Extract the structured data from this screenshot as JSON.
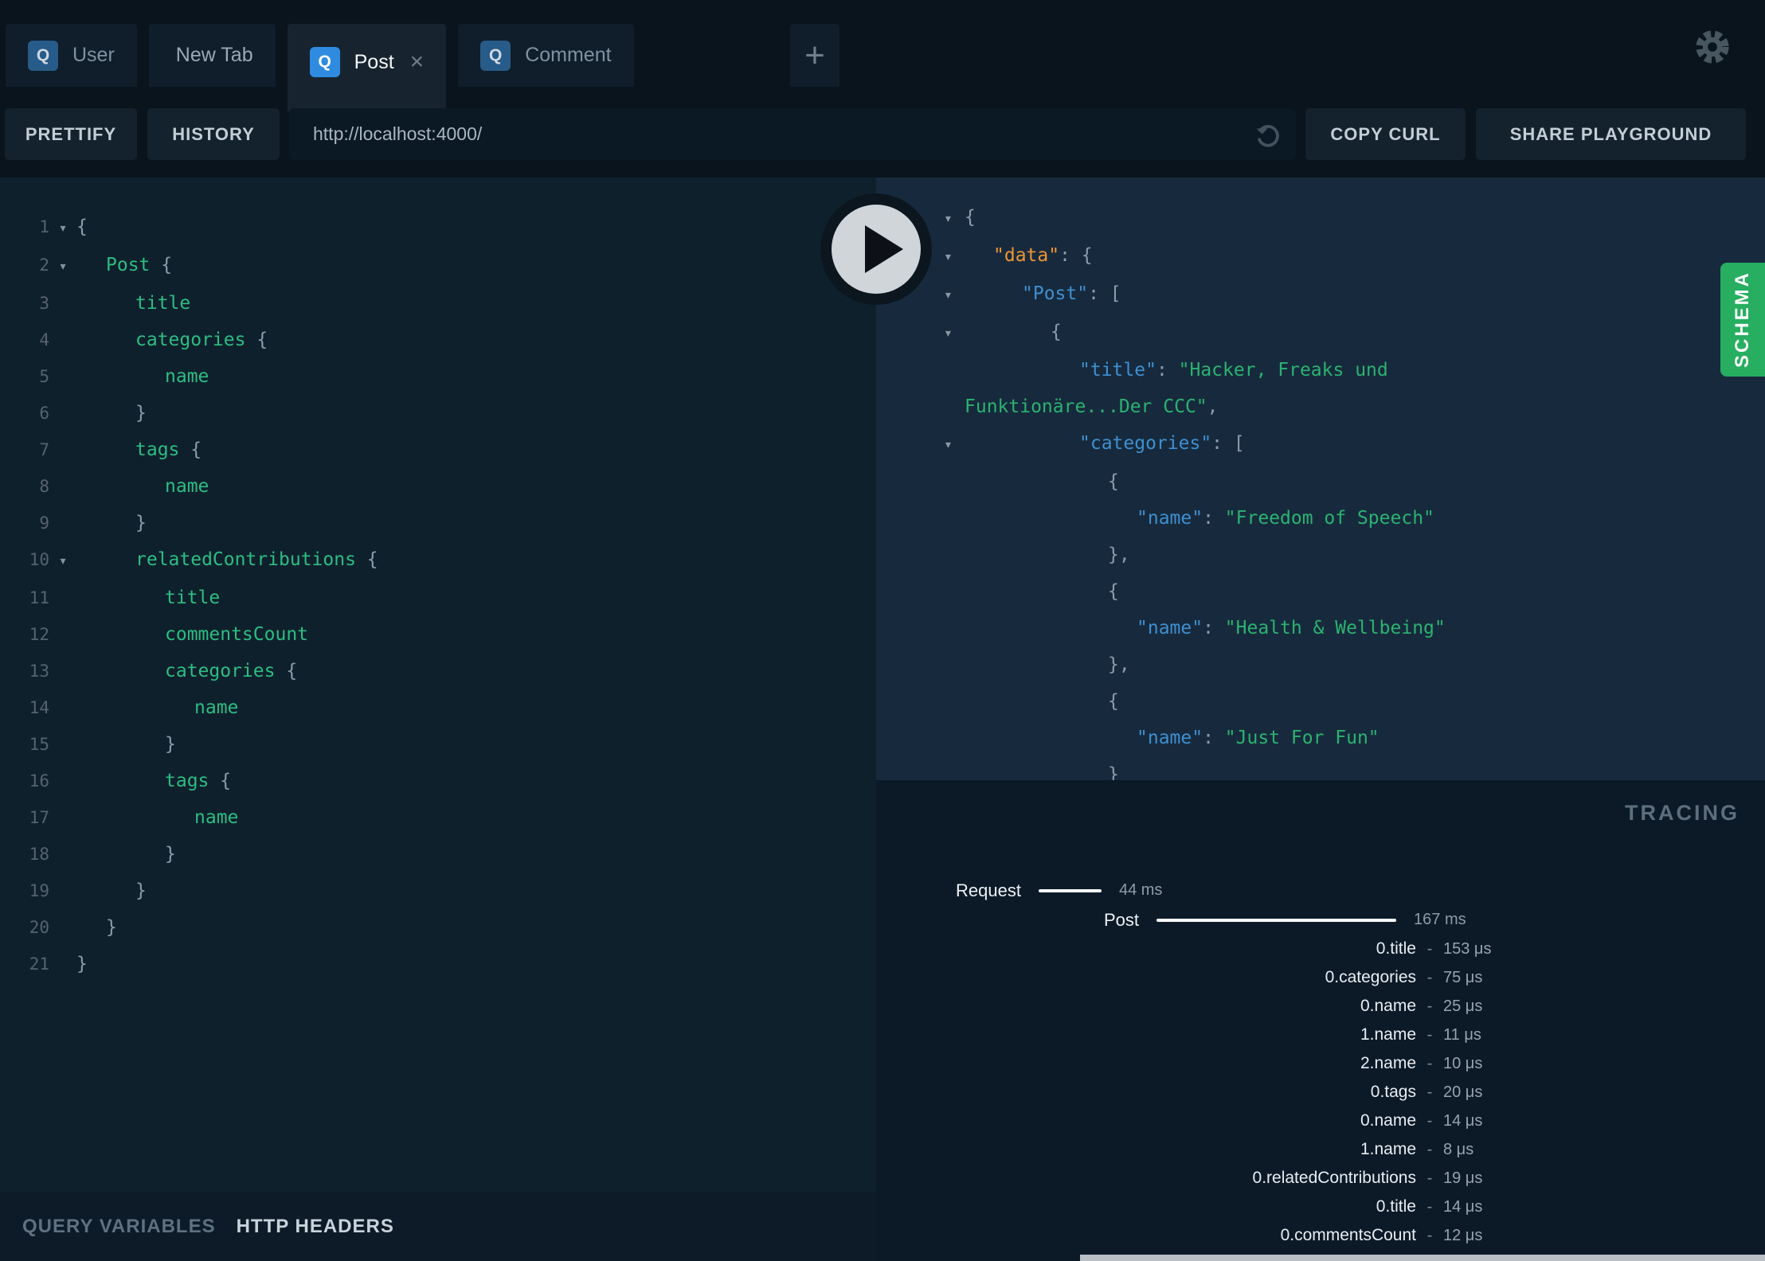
{
  "icons": {
    "fold": "▾",
    "close": "×",
    "add": "+",
    "gear": "gear-icon",
    "refresh": "refresh-icon",
    "play": "play-icon"
  },
  "colors": {
    "accent_green": "#27ae60",
    "badge_active_blue": "#2f8be0",
    "badge_inactive_blue": "#275b89",
    "key_blue": "#3f8fd0",
    "string_green": "#2cb270",
    "field_green": "#2dbd80",
    "data_orange": "#ee9435"
  },
  "tabs": {
    "items": [
      {
        "label": "User",
        "badge": "Q",
        "active": false,
        "closable": false
      },
      {
        "label": "New Tab",
        "badge": "",
        "active": false,
        "closable": false
      },
      {
        "label": "Post",
        "badge": "Q",
        "active": true,
        "closable": true
      },
      {
        "label": "Comment",
        "badge": "Q",
        "active": false,
        "closable": false
      }
    ]
  },
  "toolbar": {
    "prettify_label": "PRETTIFY",
    "history_label": "HISTORY",
    "url_value": "http://localhost:4000/",
    "copy_curl_label": "COPY CURL",
    "share_label": "SHARE PLAYGROUND"
  },
  "query_editor": {
    "lines": [
      {
        "n": 1,
        "fold": true,
        "indent": 0,
        "seg": [
          [
            "p",
            "{"
          ]
        ]
      },
      {
        "n": 2,
        "fold": true,
        "indent": 1,
        "seg": [
          [
            "f",
            "Post"
          ],
          [
            "p",
            " {"
          ]
        ]
      },
      {
        "n": 3,
        "fold": false,
        "indent": 2,
        "seg": [
          [
            "f",
            "title"
          ]
        ]
      },
      {
        "n": 4,
        "fold": false,
        "indent": 2,
        "seg": [
          [
            "f",
            "categories"
          ],
          [
            "p",
            " {"
          ]
        ]
      },
      {
        "n": 5,
        "fold": false,
        "indent": 3,
        "seg": [
          [
            "f",
            "name"
          ]
        ]
      },
      {
        "n": 6,
        "fold": false,
        "indent": 2,
        "seg": [
          [
            "p",
            "}"
          ]
        ]
      },
      {
        "n": 7,
        "fold": false,
        "indent": 2,
        "seg": [
          [
            "f",
            "tags"
          ],
          [
            "p",
            " {"
          ]
        ]
      },
      {
        "n": 8,
        "fold": false,
        "indent": 3,
        "seg": [
          [
            "f",
            "name"
          ]
        ]
      },
      {
        "n": 9,
        "fold": false,
        "indent": 2,
        "seg": [
          [
            "p",
            "}"
          ]
        ]
      },
      {
        "n": 10,
        "fold": true,
        "indent": 2,
        "seg": [
          [
            "f",
            "relatedContributions"
          ],
          [
            "p",
            " {"
          ]
        ]
      },
      {
        "n": 11,
        "fold": false,
        "indent": 3,
        "seg": [
          [
            "f",
            "title"
          ]
        ]
      },
      {
        "n": 12,
        "fold": false,
        "indent": 3,
        "seg": [
          [
            "f",
            "commentsCount"
          ]
        ]
      },
      {
        "n": 13,
        "fold": false,
        "indent": 3,
        "seg": [
          [
            "f",
            "categories"
          ],
          [
            "p",
            " {"
          ]
        ]
      },
      {
        "n": 14,
        "fold": false,
        "indent": 4,
        "seg": [
          [
            "f",
            "name"
          ]
        ]
      },
      {
        "n": 15,
        "fold": false,
        "indent": 3,
        "seg": [
          [
            "p",
            "}"
          ]
        ]
      },
      {
        "n": 16,
        "fold": false,
        "indent": 3,
        "seg": [
          [
            "f",
            "tags"
          ],
          [
            "p",
            " {"
          ]
        ]
      },
      {
        "n": 17,
        "fold": false,
        "indent": 4,
        "seg": [
          [
            "f",
            "name"
          ]
        ]
      },
      {
        "n": 18,
        "fold": false,
        "indent": 3,
        "seg": [
          [
            "p",
            "}"
          ]
        ]
      },
      {
        "n": 19,
        "fold": false,
        "indent": 2,
        "seg": [
          [
            "p",
            "}"
          ]
        ]
      },
      {
        "n": 20,
        "fold": false,
        "indent": 1,
        "seg": [
          [
            "p",
            "}"
          ]
        ]
      },
      {
        "n": 21,
        "fold": false,
        "indent": 0,
        "seg": [
          [
            "p",
            "}"
          ]
        ]
      }
    ]
  },
  "response": {
    "lines": [
      {
        "fold": true,
        "indent": 0,
        "seg": [
          [
            "p",
            "{"
          ]
        ]
      },
      {
        "fold": true,
        "indent": 1,
        "seg": [
          [
            "o",
            "\"data\""
          ],
          [
            "p",
            ": {"
          ]
        ]
      },
      {
        "fold": true,
        "indent": 2,
        "seg": [
          [
            "k",
            "\"Post\""
          ],
          [
            "p",
            ": ["
          ]
        ]
      },
      {
        "fold": true,
        "indent": 3,
        "seg": [
          [
            "p",
            "{"
          ]
        ]
      },
      {
        "fold": false,
        "indent": 4,
        "seg": [
          [
            "k",
            "\"title\""
          ],
          [
            "p",
            ": "
          ],
          [
            "s",
            "\"Hacker, Freaks und"
          ]
        ]
      },
      {
        "fold": false,
        "indent": 0,
        "seg": [
          [
            "s",
            "Funktionäre...Der CCC\""
          ],
          [
            "p",
            ","
          ]
        ]
      },
      {
        "fold": true,
        "indent": 4,
        "seg": [
          [
            "k",
            "\"categories\""
          ],
          [
            "p",
            ": ["
          ]
        ]
      },
      {
        "fold": false,
        "indent": 5,
        "seg": [
          [
            "p",
            "{"
          ]
        ]
      },
      {
        "fold": false,
        "indent": 6,
        "seg": [
          [
            "k",
            "\"name\""
          ],
          [
            "p",
            ": "
          ],
          [
            "s",
            "\"Freedom of Speech\""
          ]
        ]
      },
      {
        "fold": false,
        "indent": 5,
        "seg": [
          [
            "p",
            "},"
          ]
        ]
      },
      {
        "fold": false,
        "indent": 5,
        "seg": [
          [
            "p",
            "{"
          ]
        ]
      },
      {
        "fold": false,
        "indent": 6,
        "seg": [
          [
            "k",
            "\"name\""
          ],
          [
            "p",
            ": "
          ],
          [
            "s",
            "\"Health & Wellbeing\""
          ]
        ]
      },
      {
        "fold": false,
        "indent": 5,
        "seg": [
          [
            "p",
            "},"
          ]
        ]
      },
      {
        "fold": false,
        "indent": 5,
        "seg": [
          [
            "p",
            "{"
          ]
        ]
      },
      {
        "fold": false,
        "indent": 6,
        "seg": [
          [
            "k",
            "\"name\""
          ],
          [
            "p",
            ": "
          ],
          [
            "s",
            "\"Just For Fun\""
          ]
        ]
      },
      {
        "fold": false,
        "indent": 5,
        "seg": [
          [
            "p",
            "}"
          ]
        ]
      },
      {
        "fold": false,
        "indent": 4,
        "seg": [
          [
            "p",
            "]"
          ]
        ]
      }
    ]
  },
  "schema_tab": {
    "label": "SCHEMA"
  },
  "tracing": {
    "title": "TRACING",
    "bars": [
      {
        "label": "Request",
        "duration": "44 ms",
        "ms": 44,
        "depth": 0
      },
      {
        "label": "Post",
        "duration": "167 ms",
        "ms": 167,
        "depth": 1
      }
    ],
    "rows": [
      {
        "label": "0.title",
        "value": "153 μs"
      },
      {
        "label": "0.categories",
        "value": "75 μs"
      },
      {
        "label": "0.name",
        "value": "25 μs"
      },
      {
        "label": "1.name",
        "value": "11 μs"
      },
      {
        "label": "2.name",
        "value": "10 μs"
      },
      {
        "label": "0.tags",
        "value": "20 μs"
      },
      {
        "label": "0.name",
        "value": "14 μs"
      },
      {
        "label": "1.name",
        "value": "8 μs"
      },
      {
        "label": "0.relatedContributions",
        "value": "19 μs"
      },
      {
        "label": "0.title",
        "value": "14 μs"
      },
      {
        "label": "0.commentsCount",
        "value": "12 μs"
      }
    ]
  },
  "bottom_bar": {
    "query_variables_label": "QUERY VARIABLES",
    "http_headers_label": "HTTP HEADERS"
  }
}
